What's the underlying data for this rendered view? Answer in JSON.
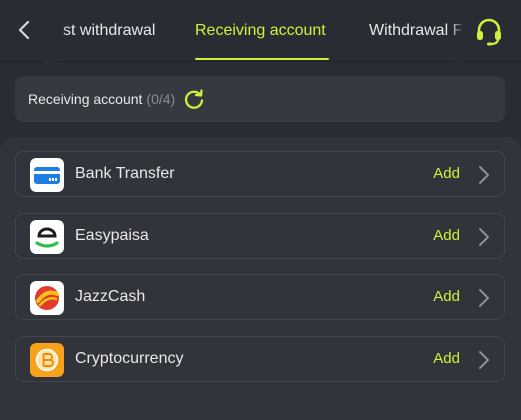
{
  "header": {
    "tabs": [
      {
        "label": "st withdrawal"
      },
      {
        "label": "Receiving account"
      },
      {
        "label": "Withdrawal F"
      }
    ],
    "active_tab": 1,
    "accent_color": "#cdf23a"
  },
  "summary": {
    "label": "Receiving account",
    "count": "(0/4)"
  },
  "methods": [
    {
      "name": "Bank Transfer",
      "action": "Add",
      "icon": "bank-card-icon"
    },
    {
      "name": "Easypaisa",
      "action": "Add",
      "icon": "easypaisa-logo"
    },
    {
      "name": "JazzCash",
      "action": "Add",
      "icon": "jazzcash-logo"
    },
    {
      "name": "Cryptocurrency",
      "action": "Add",
      "icon": "bitcoin-coin-icon"
    }
  ]
}
